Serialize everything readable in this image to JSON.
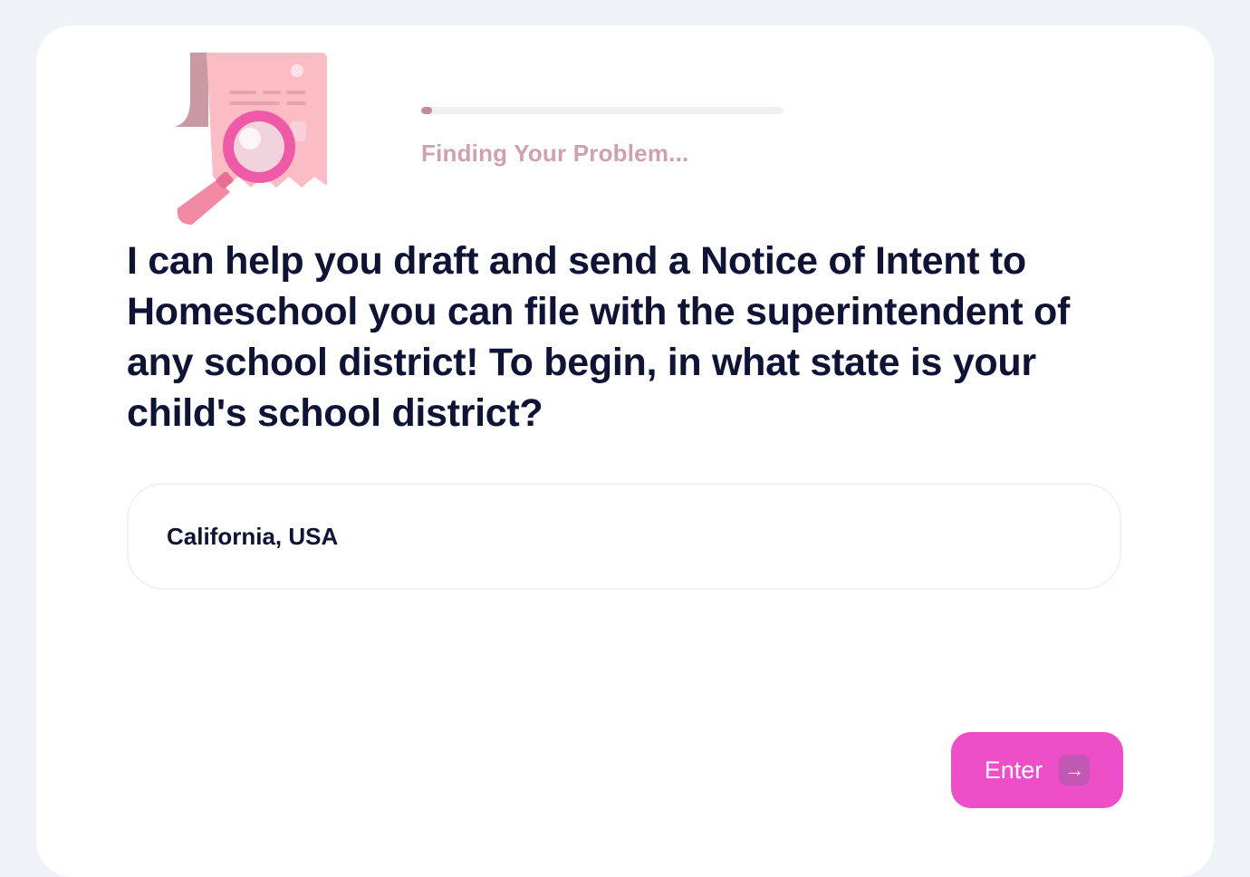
{
  "progress": {
    "fraction": 0.03,
    "status": "Finding Your Problem..."
  },
  "question": {
    "text": "I can help you draft and send a Notice of Intent to Homeschool you can file with the superintendent of any school district! To begin, in what state is your child's school district?"
  },
  "answer": {
    "value": "California, USA"
  },
  "enter_button": {
    "label": "Enter",
    "icon": "arrow-right-icon"
  },
  "illustration": {
    "icon": "document-magnifier-icon"
  },
  "colors": {
    "background": "#eff2f7",
    "card": "#ffffff",
    "accent": "#ee4fc9",
    "text": "#0f1335",
    "status_text": "#d0a0ac",
    "progress_fill": "#c48b9a"
  }
}
